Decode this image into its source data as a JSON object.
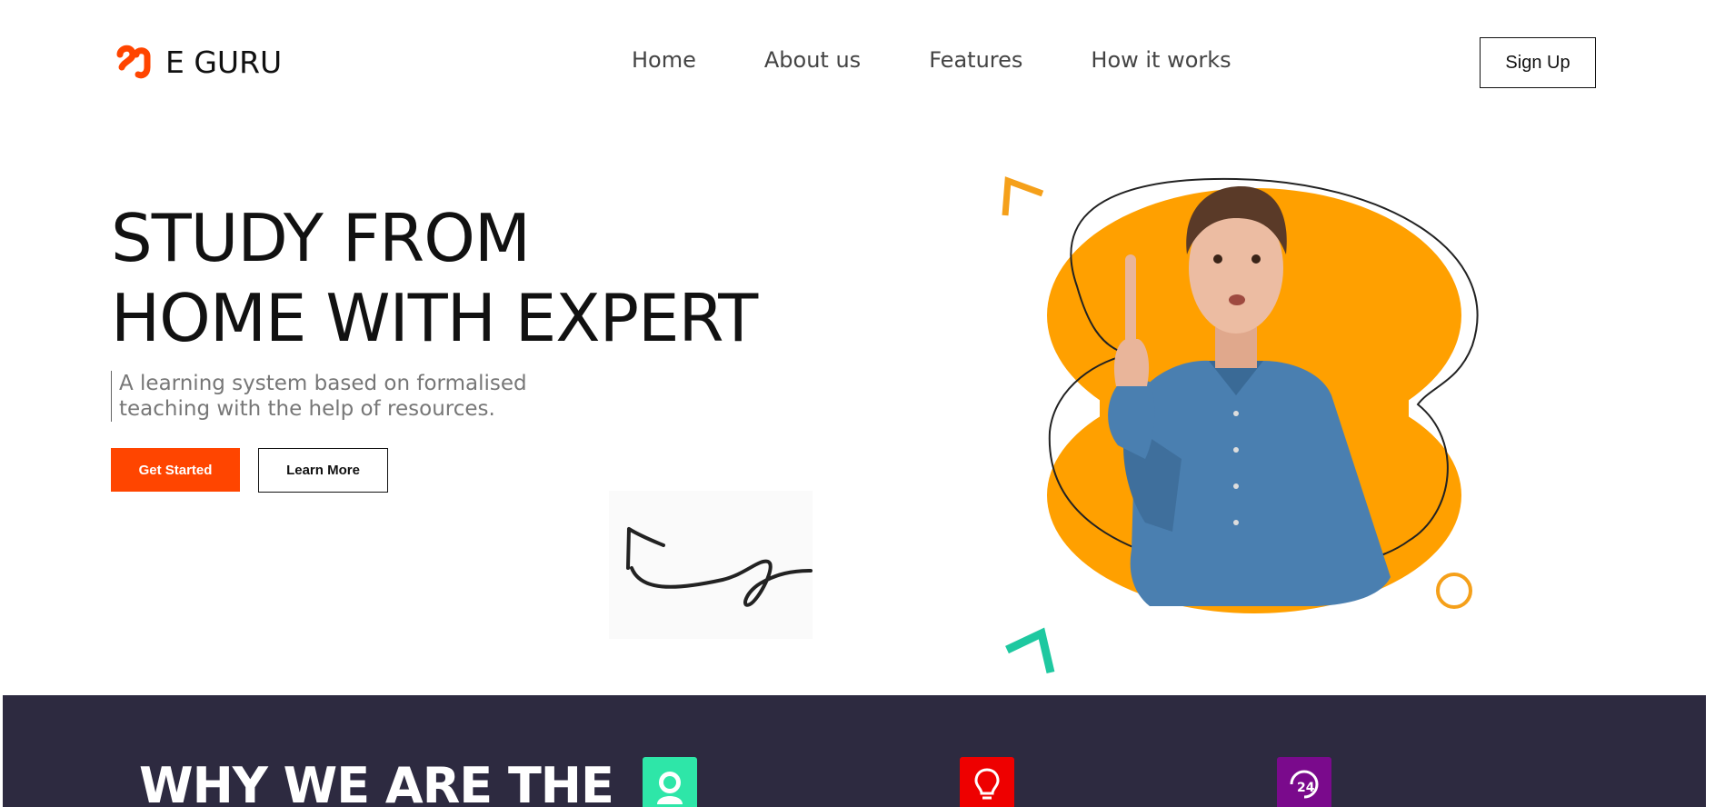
{
  "brand": {
    "name": "E GURU",
    "logo_icon": "eguru-logo-icon",
    "accent_color": "#ff4500"
  },
  "nav": {
    "items": [
      {
        "label": "Home"
      },
      {
        "label": "About us"
      },
      {
        "label": "Features"
      },
      {
        "label": "How it works"
      }
    ],
    "signup_label": "Sign Up"
  },
  "hero": {
    "title_lines": [
      "STUDY FROM",
      "HOME WITH EXPERT"
    ],
    "subtitle_lines": [
      "A learning system based on formalised",
      "teaching with the help of resources."
    ],
    "primary_button": "Get Started",
    "secondary_button": "Learn More",
    "image_alt": "student-pointing-finger-image",
    "blob_color": "#ffa000",
    "confetti_colors": {
      "orange": "#f5a01a",
      "teal": "#1ec8a0"
    }
  },
  "why_section": {
    "title": "WHY WE ARE THE",
    "background": "#2d2a40",
    "icons": [
      {
        "name": "support-agent-icon",
        "color": "#2ee6a8"
      },
      {
        "name": "lightbulb-icon",
        "color": "#ee0000"
      },
      {
        "name": "24-hours-icon",
        "color": "#7a0a8c"
      }
    ]
  }
}
